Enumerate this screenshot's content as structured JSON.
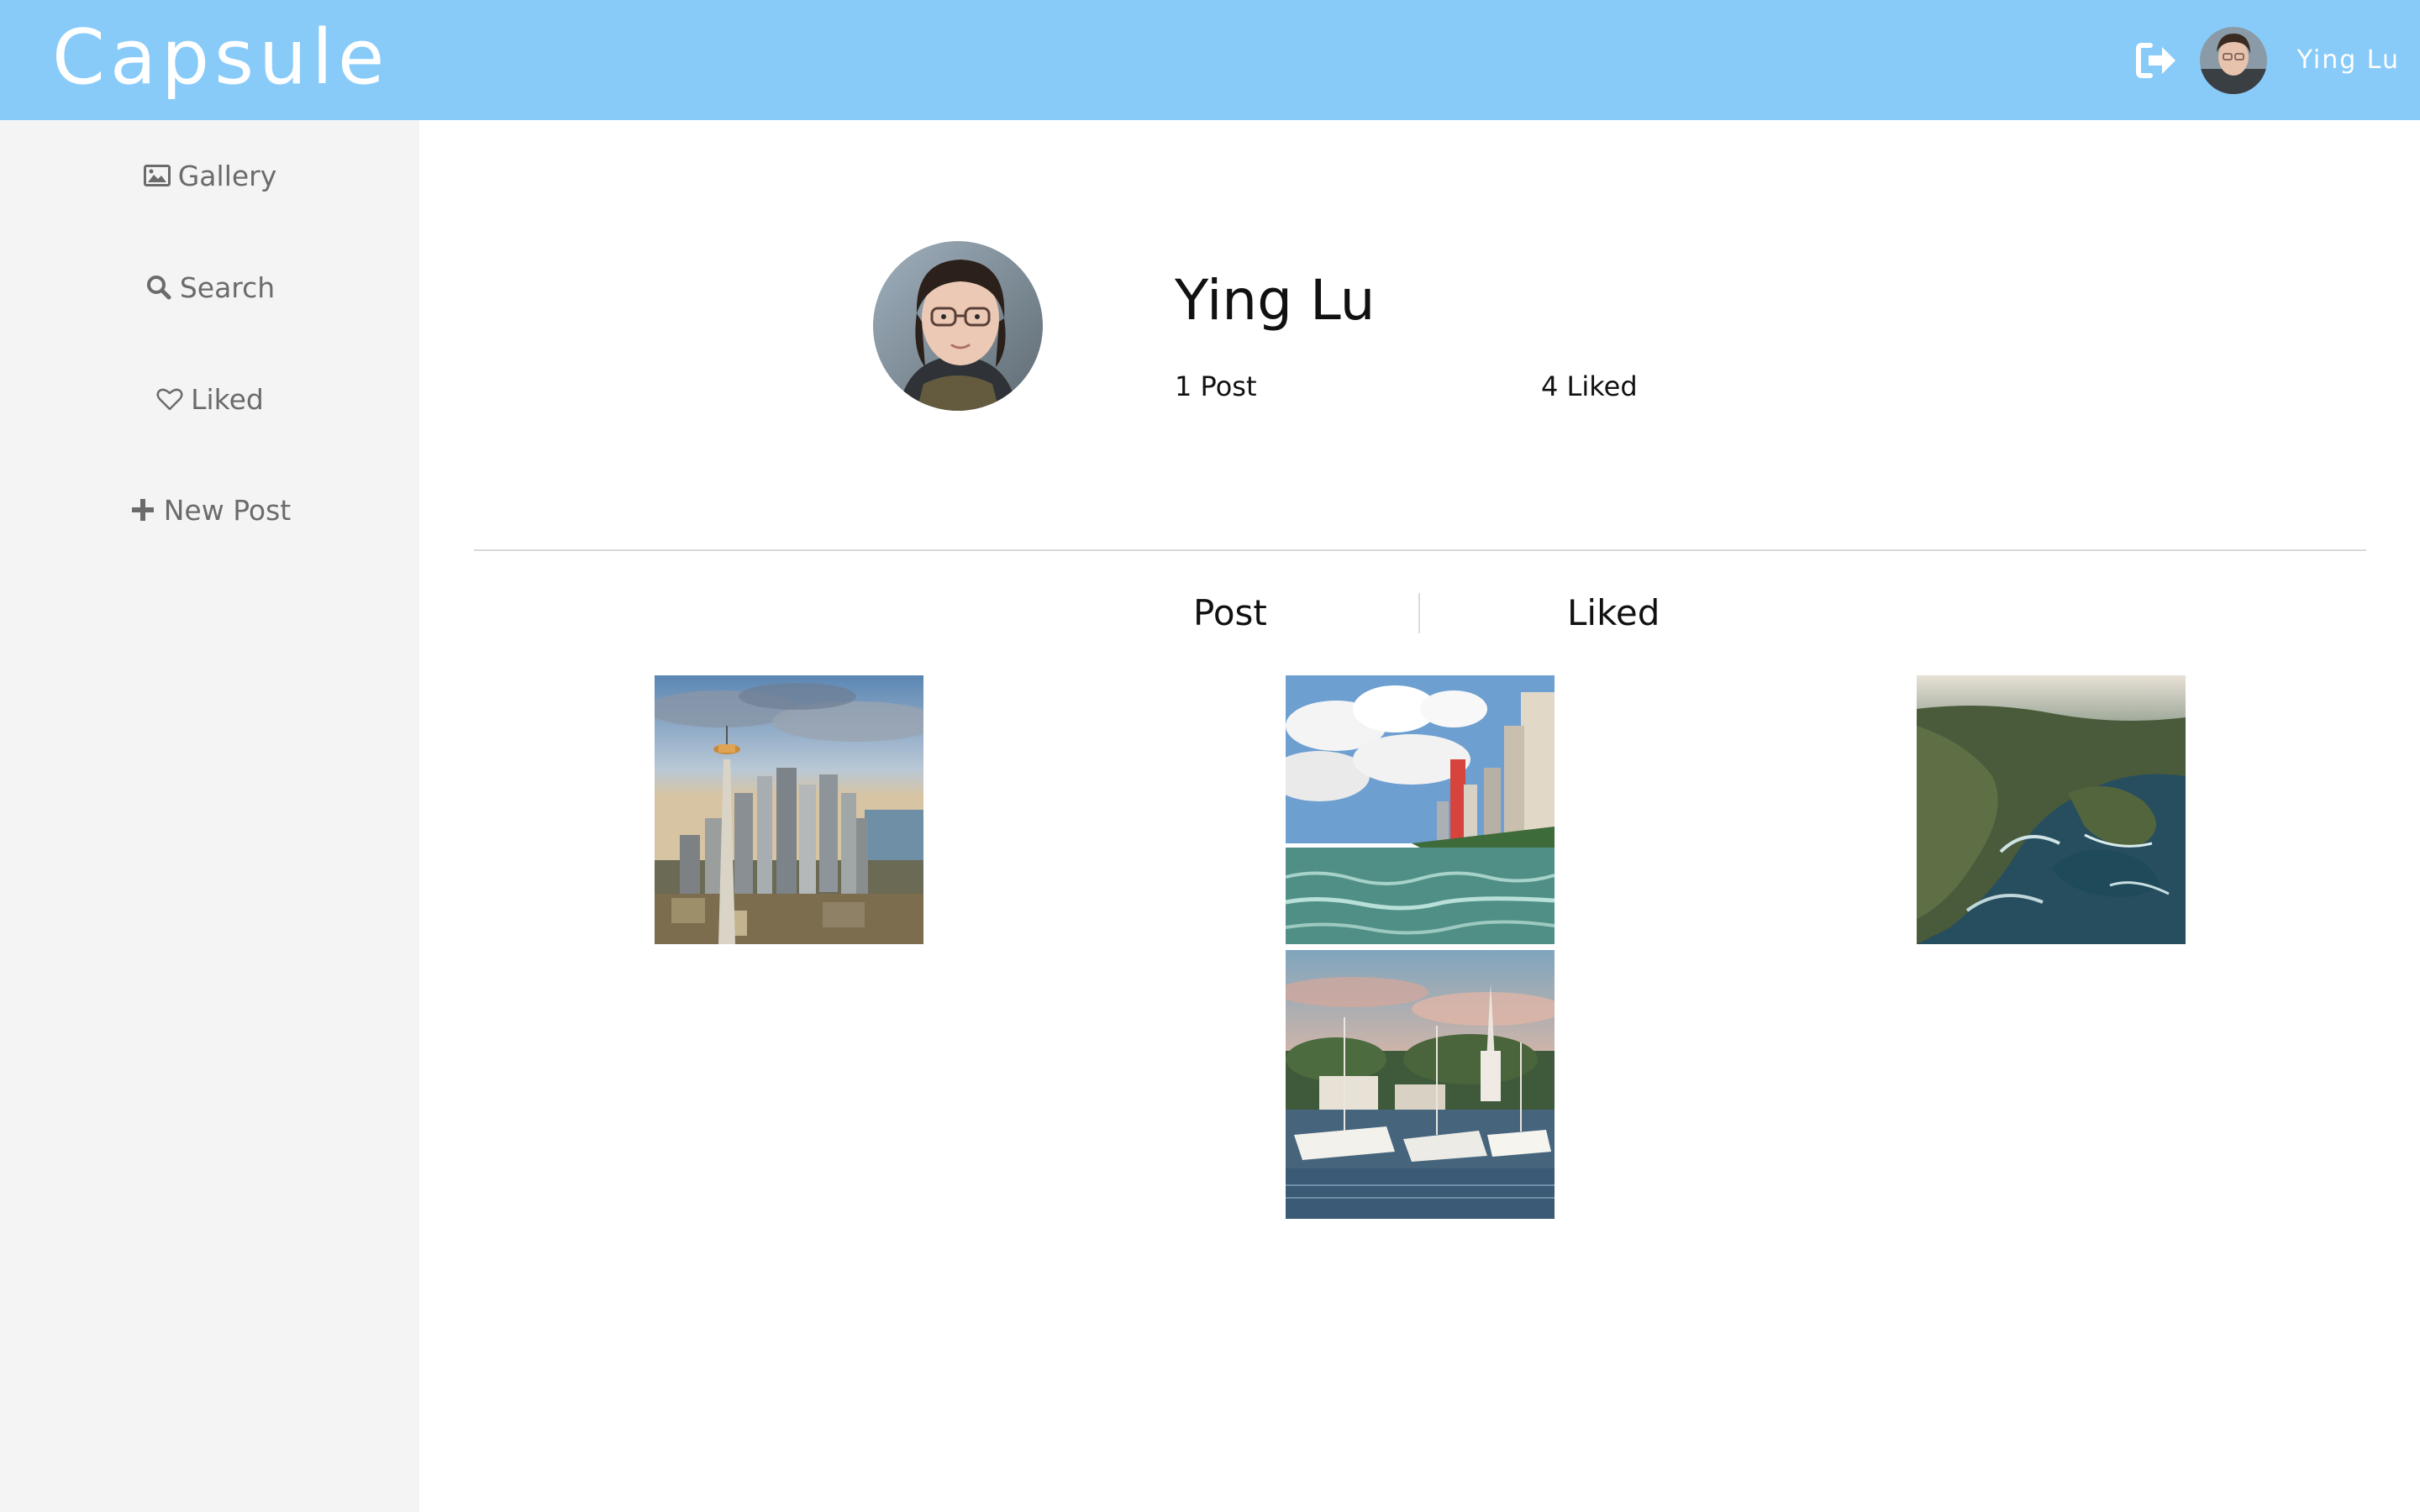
{
  "header": {
    "brand": "Capsule",
    "username": "Ying Lu",
    "icons": {
      "logout": "logout-icon",
      "avatar": "user-avatar"
    },
    "colors": {
      "header_bg": "#88cbf9"
    }
  },
  "sidebar": {
    "items": [
      {
        "label": "Gallery",
        "icon": "image-icon"
      },
      {
        "label": "Search",
        "icon": "search-icon"
      },
      {
        "label": "Liked",
        "icon": "heart-icon"
      },
      {
        "label": "New Post",
        "icon": "plus-icon"
      }
    ]
  },
  "profile": {
    "name": "Ying Lu",
    "posts_label": "1 Post",
    "liked_label": "4 Liked"
  },
  "tabs": [
    {
      "label": "Post"
    },
    {
      "label": "Liked"
    }
  ],
  "photos": [
    {
      "subject": "city-skyline-tower"
    },
    {
      "subject": "beach-highrises"
    },
    {
      "subject": "harbor-boats-church"
    },
    {
      "subject": "coastal-cliffs-aerial"
    }
  ]
}
